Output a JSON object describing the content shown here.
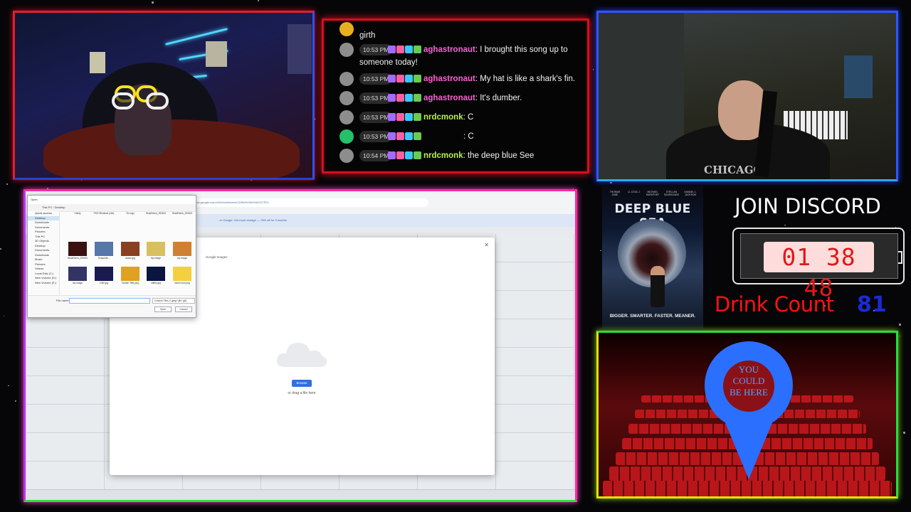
{
  "colors": {
    "chat_border": "#d01020",
    "cam_left_border": "#e02030",
    "cam_right_border": "#3055ff",
    "screen_border": "#ff2aa0",
    "theater_border": "#20e040",
    "drink_label": "#ff1111",
    "drink_value": "#1a2ad8",
    "pin": "#2b6fff"
  },
  "chat": {
    "messages": [
      {
        "time": "",
        "user": "",
        "text": "girth",
        "user_color": "#ffffff",
        "avatar_icon": "trophy-avatar-icon"
      },
      {
        "time": "10:53 PM",
        "user": "aghastronaut",
        "text": ": I brought this song up to",
        "text2": "someone today!",
        "user_color": "#ff5fd2",
        "avatar_icon": "user-avatar-icon"
      },
      {
        "time": "10:53 PM",
        "user": "aghastronaut",
        "text": ": My hat is like a shark's fin.",
        "user_color": "#ff5fd2",
        "avatar_icon": "user-avatar-icon"
      },
      {
        "time": "10:53 PM",
        "user": "aghastronaut",
        "text": ": It's dumber.",
        "user_color": "#ff5fd2",
        "avatar_icon": "user-avatar-icon"
      },
      {
        "time": "10:53 PM",
        "user": "nrdcmonk",
        "text": ": C",
        "user_color": "#b8f04a",
        "avatar_icon": "user-avatar-icon"
      },
      {
        "time": "10:53 PM",
        "user": "",
        "text": ": C",
        "user_color": "#1e34e0",
        "avatar_icon": "default-avatar-icon"
      },
      {
        "time": "10:54 PM",
        "user": "nrdcmonk",
        "text": ": the deep blue See",
        "user_color": "#b8f04a",
        "avatar_icon": "user-avatar-icon"
      }
    ]
  },
  "screen": {
    "url": "drive.google.com/u/0/drive/folders/1Zlt9vRH2bOH6OZ7JP2...",
    "banner": "...in Google. Get more storage — 78% off for 3 months",
    "dialog_tab": "Google Images",
    "browse_label": "Browse",
    "drag_text": "or drag a file here",
    "file_dialog": {
      "title": "Open",
      "path": "This PC  ›  Desktop",
      "nav": [
        "Quick access",
        "Desktop",
        "Downloads",
        "Documents",
        "Pictures",
        "This PC",
        "3D Objects",
        "Desktop",
        "Documents",
        "Downloads",
        "Music",
        "Pictures",
        "Videos",
        "Local Disk (C:)",
        "New Volume (D:)",
        "New Volume (E:)"
      ],
      "files": [
        "Clarity",
        "PSO Windows (x64)",
        "TA Logo",
        "HeadHorns_200621",
        "HeadHorns_200621",
        "HeadHorns_200621",
        "Snapchat...",
        "shaun.jpg",
        "top image",
        "top image",
        "top image",
        "1080.jpg",
        "Golden Tiles.png",
        "caffee.jpg",
        "sound icon.png"
      ],
      "filename_label": "File name:",
      "filetype": "Custom Files (*.jpeg;*.jfif;*.gif)",
      "open_label": "Open",
      "cancel_label": "Cancel"
    }
  },
  "poster": {
    "actors": [
      "THOMAS JANE",
      "LL COOL J",
      "MICHAEL RAPAPORT",
      "STELLAN SKARSGARD",
      "SAMUEL L. JACKSON"
    ],
    "title": "DEEP BLUE SEA",
    "tagline": "BIGGER. SMARTER. FASTER. MEANER."
  },
  "overlay": {
    "join_discord": "JOIN DISCORD",
    "timer": "01 38 48",
    "drink_label": "Drink Count",
    "drink_value": "81"
  },
  "theater": {
    "pin_text_1": "YOU",
    "pin_text_2": "COULD",
    "pin_text_3": "BE HERE"
  }
}
